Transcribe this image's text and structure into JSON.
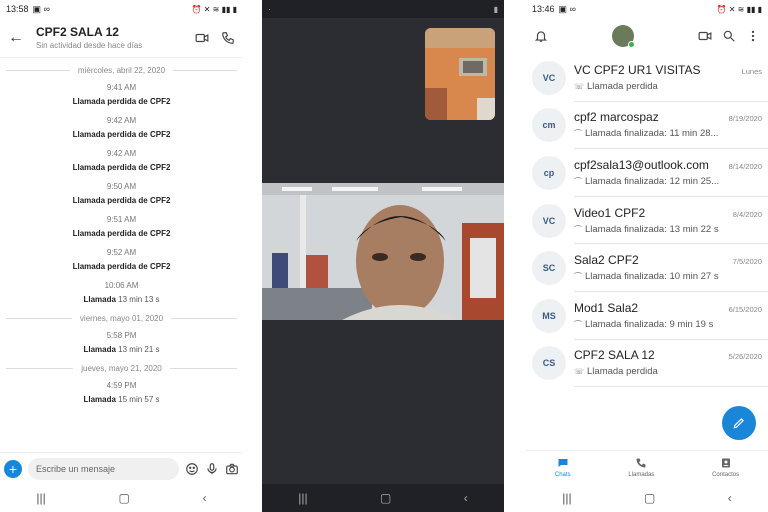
{
  "panel1": {
    "status_time": "13:58",
    "chat_title": "CPF2 SALA 12",
    "chat_subtitle": "Sin actividad desde hace días",
    "items": [
      {
        "kind": "date",
        "label": "miércoles, abril 22, 2020"
      },
      {
        "kind": "msg",
        "time": "9:41 AM",
        "text": "Llamada perdida de CPF2",
        "dur": ""
      },
      {
        "kind": "msg",
        "time": "9:42 AM",
        "text": "Llamada perdida de CPF2",
        "dur": ""
      },
      {
        "kind": "msg",
        "time": "9:42 AM",
        "text": "Llamada perdida de CPF2",
        "dur": ""
      },
      {
        "kind": "msg",
        "time": "9:50 AM",
        "text": "Llamada perdida de CPF2",
        "dur": ""
      },
      {
        "kind": "msg",
        "time": "9:51 AM",
        "text": "Llamada perdida de CPF2",
        "dur": ""
      },
      {
        "kind": "msg",
        "time": "9:52 AM",
        "text": "Llamada perdida de CPF2",
        "dur": ""
      },
      {
        "kind": "msg",
        "time": "10:06 AM",
        "text": "Llamada",
        "dur": "13 min 13 s"
      },
      {
        "kind": "date",
        "label": "viernes, mayo 01, 2020"
      },
      {
        "kind": "msg",
        "time": "5:58 PM",
        "text": "Llamada",
        "dur": "13 min 21 s"
      },
      {
        "kind": "date",
        "label": "jueves, mayo 21, 2020"
      },
      {
        "kind": "msg",
        "time": "4:59 PM",
        "text": "Llamada",
        "dur": "15 min 57 s"
      }
    ],
    "composer_placeholder": "Escribe un mensaje"
  },
  "panel3": {
    "status_time": "13:46",
    "chats": [
      {
        "initials": "VC",
        "name": "VC CPF2  UR1 VISITAS",
        "date": "Lunes",
        "sub_icon": "missed-call-icon",
        "sub": "Llamada perdida"
      },
      {
        "initials": "cm",
        "name": "cpf2 marcospaz",
        "date": "8/19/2020",
        "sub_icon": "call-ended-icon",
        "sub": "Llamada finalizada: 11 min 28..."
      },
      {
        "initials": "cp",
        "name": "cpf2sala13@outlook.com",
        "date": "8/14/2020",
        "sub_icon": "call-ended-icon",
        "sub": "Llamada finalizada: 12 min 25..."
      },
      {
        "initials": "VC",
        "name": "Video1 CPF2",
        "date": "8/4/2020",
        "sub_icon": "call-ended-icon",
        "sub": "Llamada finalizada: 13 min 22 s"
      },
      {
        "initials": "SC",
        "name": "Sala2 CPF2",
        "date": "7/5/2020",
        "sub_icon": "call-ended-icon",
        "sub": "Llamada finalizada: 10 min 27 s"
      },
      {
        "initials": "MS",
        "name": "Mod1 Sala2",
        "date": "6/15/2020",
        "sub_icon": "call-ended-icon",
        "sub": "Llamada finalizada: 9 min 19 s"
      },
      {
        "initials": "CS",
        "name": "CPF2 SALA 12",
        "date": "5/26/2020",
        "sub_icon": "missed-call-icon",
        "sub": "Llamada perdida"
      }
    ],
    "tabs": [
      {
        "label": "Chats",
        "active": true
      },
      {
        "label": "Llamadas",
        "active": false
      },
      {
        "label": "Contactos",
        "active": false
      }
    ]
  },
  "colors": {
    "accent": "#1a86d8",
    "call_bg": "#2b2d33"
  }
}
